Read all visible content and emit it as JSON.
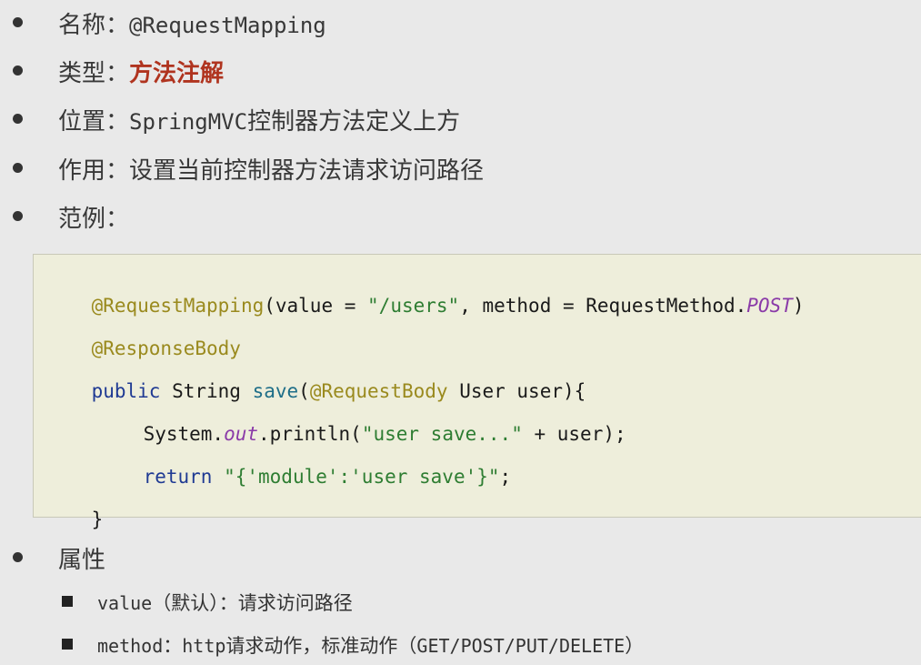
{
  "bullets": {
    "name": {
      "label": "名称：",
      "value": "@RequestMapping"
    },
    "type": {
      "label": "类型：",
      "value": "方法注解"
    },
    "position": {
      "label": "位置：",
      "value_mono": "SpringMVC",
      "value_rest": "控制器方法定义上方"
    },
    "purpose": {
      "label": "作用：",
      "value": "设置当前控制器方法请求访问路径"
    },
    "example": {
      "label": "范例："
    },
    "attributes": {
      "label": "属性"
    }
  },
  "code": {
    "line1": {
      "annotation": "@RequestMapping",
      "part_a": "(value = ",
      "path_string": "\"/users\"",
      "part_b": ", method = RequestMethod.",
      "constant": "POST",
      "part_c": ")"
    },
    "line2": {
      "annotation": "@ResponseBody"
    },
    "line3": {
      "keyword": "public",
      "part_a": " String ",
      "method_name": "save",
      "part_b": "(",
      "annotation": "@RequestBody",
      "part_c": " User user){"
    },
    "line4": {
      "part_a": "System.",
      "field": "out",
      "part_b": ".println(",
      "string": "\"user save...\"",
      "part_c": " + user);"
    },
    "line5": {
      "keyword": "return",
      "part_a": " ",
      "string": "\"{'module':'user save'}\"",
      "part_b": ";"
    },
    "line6": {
      "text": "}"
    }
  },
  "attributes": {
    "value": {
      "name": "value",
      "desc": "（默认）：请求访问路径"
    },
    "method": {
      "name": "method",
      "desc_a": "：",
      "mono": "http",
      "desc_b": "请求动作，标准动作（",
      "mono_b": "GET/POST/PUT/DELETE",
      "desc_c": "）"
    }
  }
}
